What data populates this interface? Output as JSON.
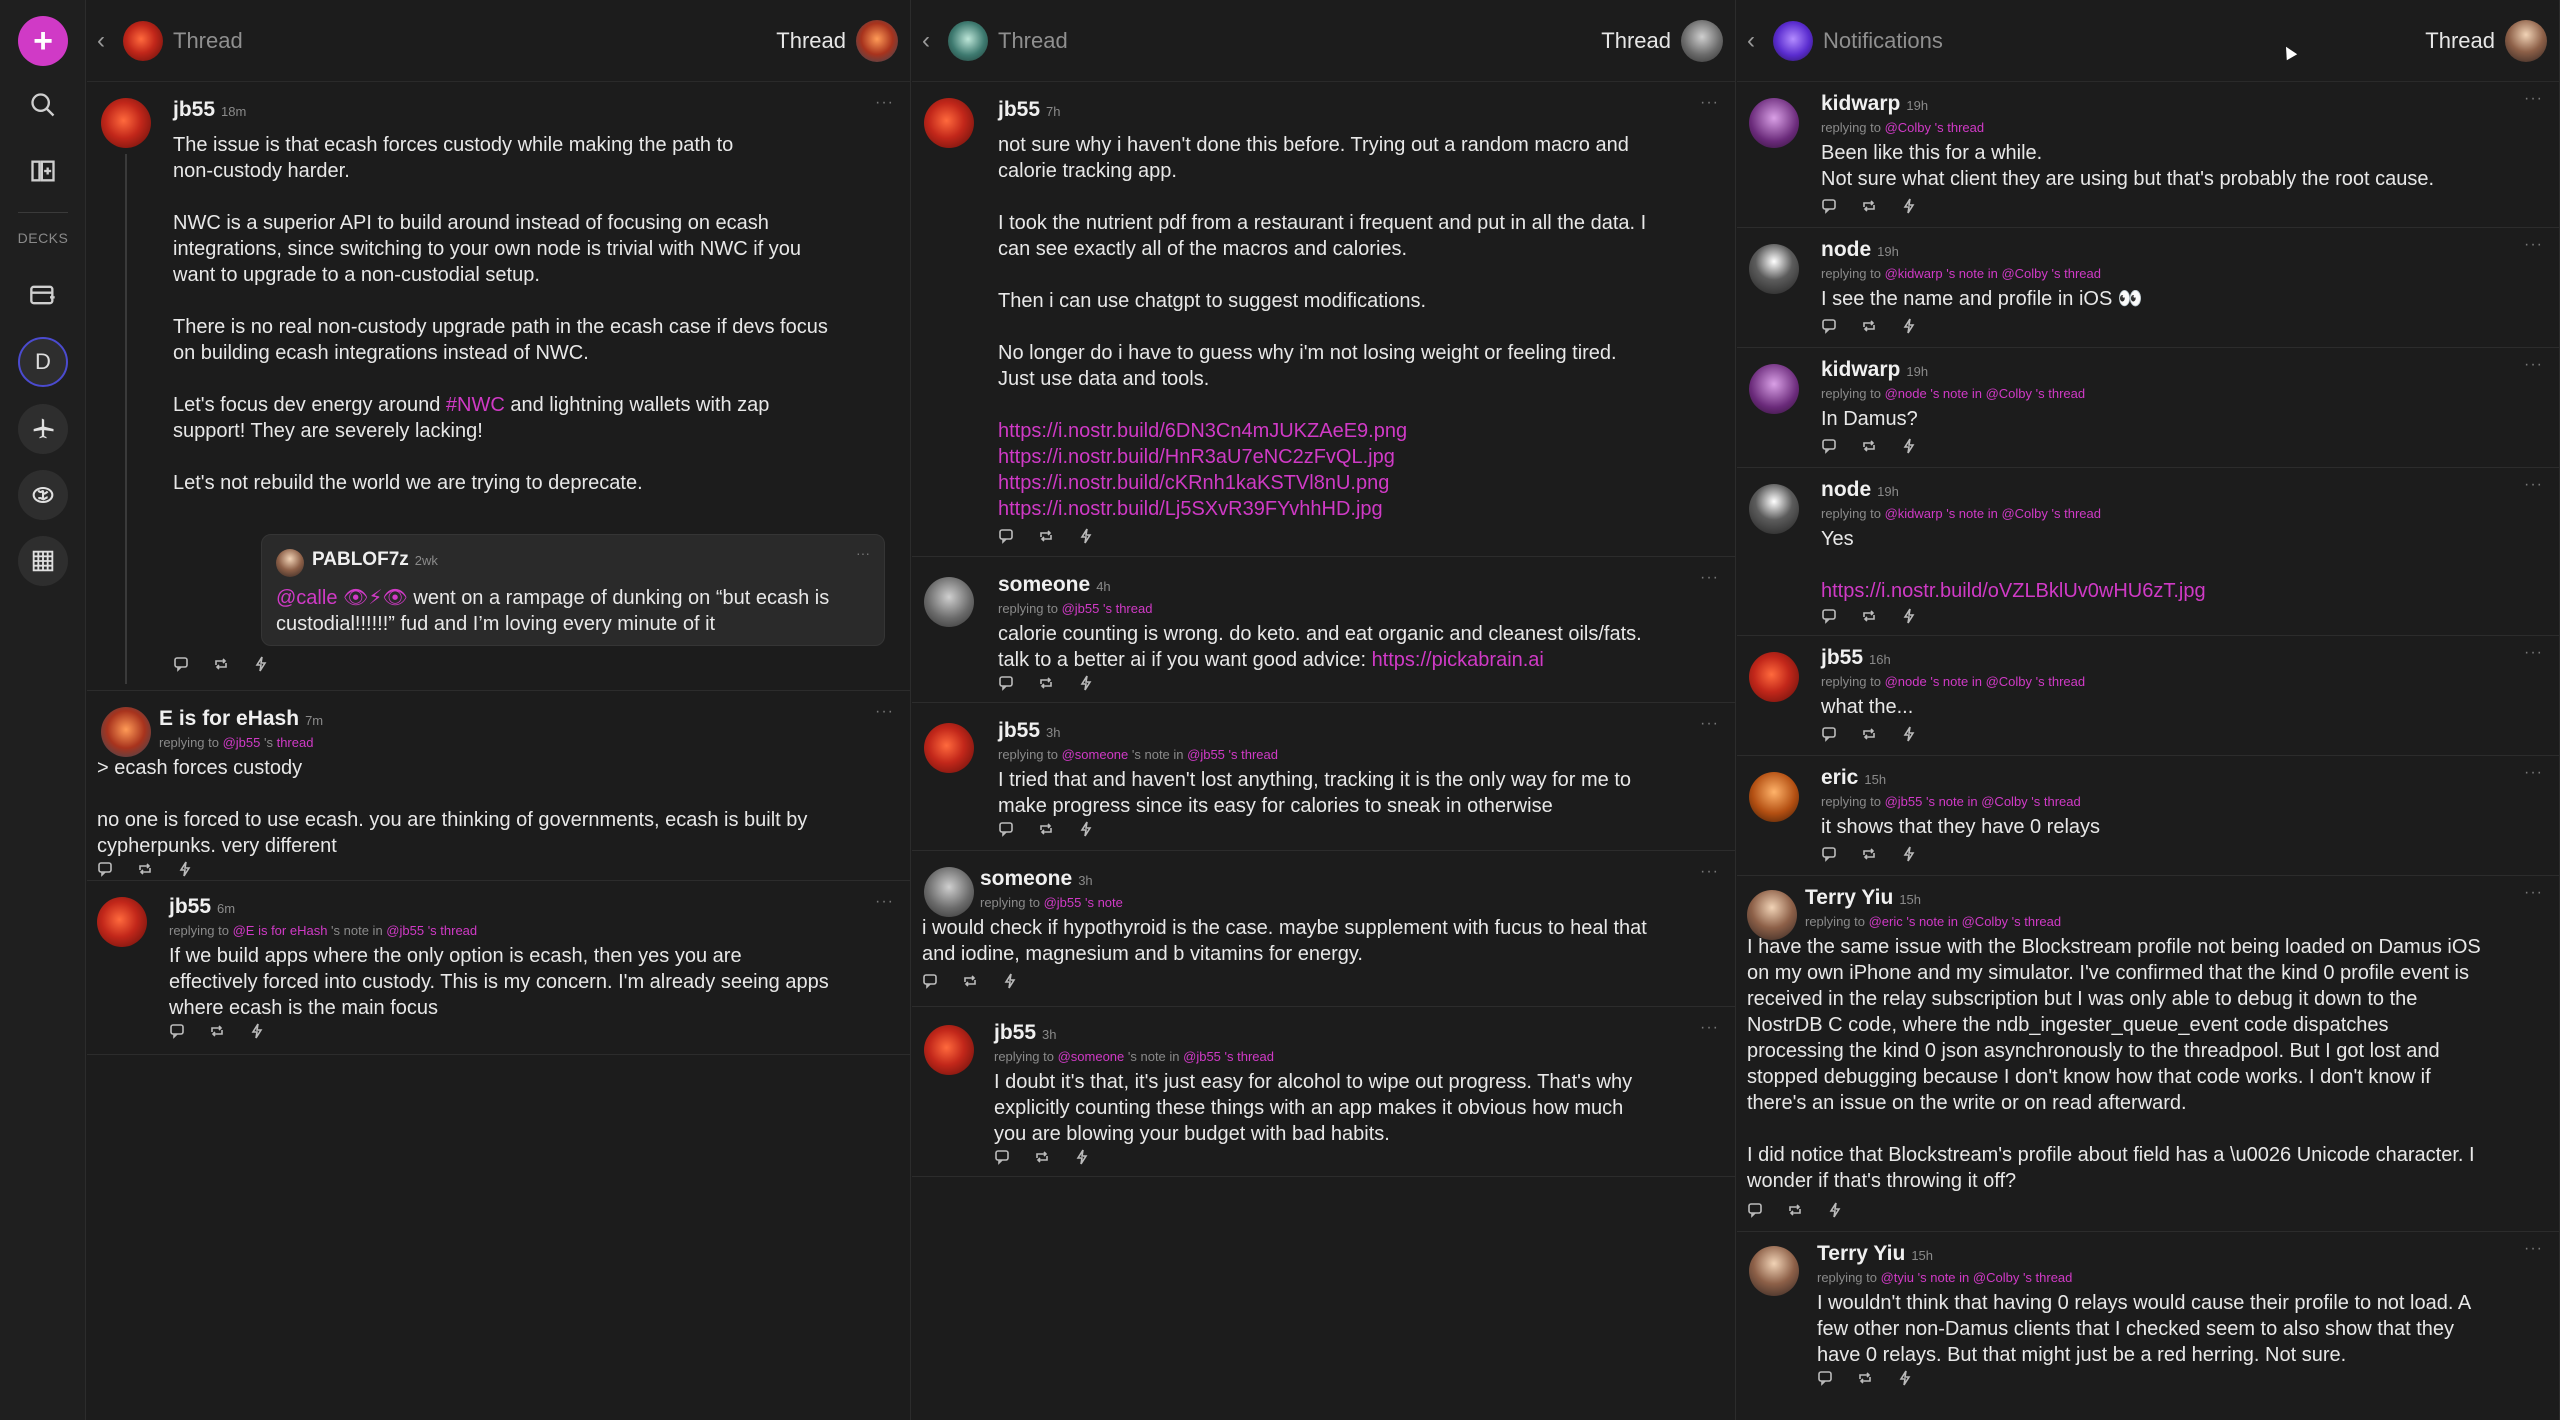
{
  "colors": {
    "accent": "#d03ac6",
    "background": "#1c1c1c",
    "text": "#e8e8e8",
    "muted": "#8a8a8a"
  },
  "sidebar": {
    "new_icon": "+",
    "decks_label": "DECKS",
    "deck_letter": "D"
  },
  "columns": [
    {
      "title": "Thread",
      "right_label": "Thread",
      "notes": [
        {
          "author": "jb55",
          "time": "18m",
          "body": "The issue is that ecash forces custody while making the path to\nnon-custody harder.\n\nNWC is a superior API to build around instead of focusing on ecash\nintegrations, since switching to your own node is trivial with NWC if you\nwant to upgrade to a non-custodial setup.\n\nThere is no real non-custody upgrade path in the ecash case if devs focus\non building ecash integrations instead of NWC.",
          "body2_pre": "Let's focus dev energy around ",
          "body2_tag": "#NWC",
          "body2_post": " and lightning wallets with zap\nsupport! They are severely lacking!",
          "body3": "Let's not rebuild the world we are trying to deprecate.",
          "quote": {
            "author": "PABLOF7z",
            "time": "2wk",
            "mention": "@calle",
            "emoji": "👁⚡👁",
            "body": " went on a rampage of dunking on “but ecash is\ncustodial!!!!!!” fud and I’m loving every minute of it"
          }
        },
        {
          "author": "E is for eHash",
          "time": "7m",
          "reply_prefix": "replying to ",
          "reply_user": "@jb55",
          "reply_mid": " 's ",
          "reply_target": "thread",
          "body": "> ecash forces custody\n\nno one is forced to use ecash. you are thinking of governments, ecash is built by\ncypherpunks. very different"
        },
        {
          "author": "jb55",
          "time": "6m",
          "reply_prefix": "replying to ",
          "reply_user": "@E is for eHash",
          "reply_mid": " 's note in ",
          "reply_user2": "@jb55",
          "reply_end": " 's thread",
          "body": "If we build apps where the only option is ecash, then yes you are\neffectively forced into custody. This is my concern. I'm already seeing apps\nwhere ecash is the main focus"
        }
      ]
    },
    {
      "title": "Thread",
      "right_label": "Thread",
      "notes": [
        {
          "author": "jb55",
          "time": "7h",
          "body": "not sure why i haven't done this before. Trying out a random macro and\ncalorie tracking app.\n\nI took the nutrient pdf from a restaurant i frequent and put in all the data. I\ncan see exactly all of the macros and calories.\n\nThen i can use chatgpt to suggest modifications.\n\nNo longer do i have to guess why i'm not losing weight or feeling tired.\nJust use data and tools.",
          "links": [
            "https://i.nostr.build/6DN3Cn4mJUKZAeE9.png",
            "https://i.nostr.build/HnR3aU7eNC2zFvQL.jpg",
            "https://i.nostr.build/cKRnh1kaKSTVl8nU.png",
            "https://i.nostr.build/Lj5SXvR39FYvhhHD.jpg"
          ]
        },
        {
          "author": "someone",
          "time": "4h",
          "reply_prefix": "replying to ",
          "reply_user": "@jb55",
          "reply_end": " 's thread",
          "body": "calorie counting is wrong. do keto. and eat organic and cleanest oils/fats.\ntalk to a better ai if you want good advice: ",
          "link": "https://pickabrain.ai"
        },
        {
          "author": "jb55",
          "time": "3h",
          "reply_prefix": "replying to ",
          "reply_user": "@someone",
          "reply_mid": " 's note in ",
          "reply_user2": "@jb55",
          "reply_end": " 's thread",
          "body": "I tried that and haven't lost anything, tracking it is the only way for me to\nmake progress since its easy for calories to sneak in otherwise"
        },
        {
          "author": "someone",
          "time": "3h",
          "reply_prefix": "replying to ",
          "reply_user": "@jb55",
          "reply_end": " 's note",
          "body": "i would check if hypothyroid is the case. maybe supplement with fucus to heal that\nand iodine, magnesium and b vitamins for energy."
        },
        {
          "author": "jb55",
          "time": "3h",
          "reply_prefix": "replying to ",
          "reply_user": "@someone",
          "reply_mid": " 's note in ",
          "reply_user2": "@jb55",
          "reply_end": " 's thread",
          "body": "I doubt it's that, it's just easy for alcohol to wipe out progress. That's why\nexplicitly counting these things with an app makes it obvious how much\nyou are blowing your budget with bad habits."
        }
      ]
    },
    {
      "title": "Notifications",
      "right_label": "Thread",
      "notes": [
        {
          "author": "kidwarp",
          "time": "19h",
          "reply_prefix": "replying to ",
          "reply_user": "@Colby",
          "reply_end": " 's thread",
          "body": "Been like this for a while.\nNot sure what client they are using but that's probably the root cause."
        },
        {
          "author": "node",
          "time": "19h",
          "reply_prefix": "replying to ",
          "reply_user": "@kidwarp",
          "reply_mid": " 's note in ",
          "reply_user2": "@Colby",
          "reply_end": " 's thread",
          "body": "I see the name and profile in iOS 👀"
        },
        {
          "author": "kidwarp",
          "time": "19h",
          "reply_prefix": "replying to ",
          "reply_user": "@node",
          "reply_mid": " 's note in ",
          "reply_user2": "@Colby",
          "reply_end": " 's thread",
          "body": "In Damus?"
        },
        {
          "author": "node",
          "time": "19h",
          "reply_prefix": "replying to ",
          "reply_user": "@kidwarp",
          "reply_mid": " 's note in ",
          "reply_user2": "@Colby",
          "reply_end": " 's thread",
          "body": "Yes",
          "link": "https://i.nostr.build/oVZLBklUv0wHU6zT.jpg"
        },
        {
          "author": "jb55",
          "time": "16h",
          "reply_prefix": "replying to ",
          "reply_user": "@node",
          "reply_mid": " 's note in ",
          "reply_user2": "@Colby",
          "reply_end": " 's thread",
          "body": "what the..."
        },
        {
          "author": "eric",
          "time": "15h",
          "reply_prefix": "replying to ",
          "reply_user": "@jb55",
          "reply_mid": " 's note in ",
          "reply_user2": "@Colby",
          "reply_end": " 's thread",
          "body": "it shows that they have 0 relays"
        },
        {
          "author": "Terry Yiu",
          "time": "15h",
          "reply_prefix": "replying to ",
          "reply_user": "@eric",
          "reply_mid": " 's note in ",
          "reply_user2": "@Colby",
          "reply_end": " 's thread",
          "body": "I have the same issue with the Blockstream profile not being loaded on Damus iOS\non my own iPhone and my simulator. I've confirmed that the kind 0 profile event is\nreceived in the relay subscription but I was only able to debug it down to the\nNostrDB C code, where the ndb_ingester_queue_event code dispatches\nprocessing the kind 0 json asynchronously to the threadpool. But I got lost and\nstopped debugging because I don't know how that code works. I don't know if\nthere's an issue on the write or on read afterward.\n\nI did notice that Blockstream's profile about field has a \\u0026 Unicode character. I\nwonder if that's throwing it off?"
        },
        {
          "author": "Terry Yiu",
          "time": "15h",
          "reply_prefix": "replying to ",
          "reply_user": "@tyiu",
          "reply_mid": " 's note in ",
          "reply_user2": "@Colby",
          "reply_end": " 's thread",
          "body": "I wouldn't think that having 0 relays would cause their profile to not load. A\nfew other non-Damus clients that I checked seem to also show that they\nhave 0 relays. But that might just be a red herring. Not sure."
        }
      ]
    }
  ],
  "dots": "···"
}
